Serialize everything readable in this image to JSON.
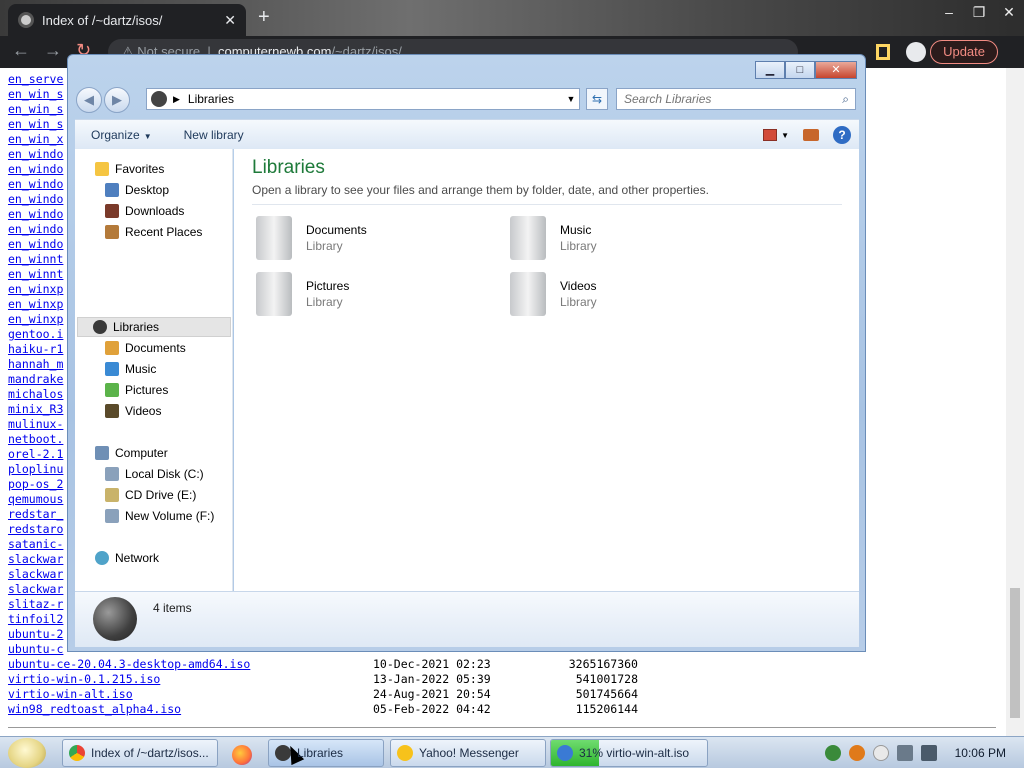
{
  "browser": {
    "tab_title": "Index of /~dartz/isos/",
    "new_tab": "+",
    "omnibox_prefix": "Not secure",
    "omnibox_host": "computernewb.com",
    "omnibox_path": "/~dartz/isos/",
    "update_label": "Update",
    "window_controls": [
      "–",
      "❐",
      "✕"
    ]
  },
  "listing": {
    "truncated_links": [
      "en_serve",
      "en_win_s",
      "en_win_s",
      "en_win_s",
      "en_win_x",
      "en_windo",
      "en_windo",
      "en_windo",
      "en_windo",
      "en_windo",
      "en_windo",
      "en_windo",
      "en_winnt",
      "en_winnt",
      "en_winxp",
      "en_winxp",
      "en_winxp",
      "gentoo.i",
      "haiku-r1",
      "hannah_m",
      "mandrake",
      "michalos",
      "minix_R3",
      "mulinux-",
      "netboot.",
      "orel-2.1",
      "ploplinu",
      "pop-os_2",
      "qemumous",
      "redstar_",
      "redstaro",
      "satanic-",
      "slackwar",
      "slackwar",
      "slackwar",
      "slitaz-r",
      "tinfoil2",
      "ubuntu-2",
      "ubuntu-c"
    ],
    "rows": [
      {
        "name": "ubuntu-ce-20.04.3-desktop-amd64.iso",
        "date": "10-Dec-2021 02:23",
        "size": "3265167360"
      },
      {
        "name": "virtio-win-0.1.215.iso",
        "date": "13-Jan-2022 05:39",
        "size": "541001728"
      },
      {
        "name": "virtio-win-alt.iso",
        "date": "24-Aug-2021 20:54",
        "size": "501745664"
      },
      {
        "name": "win98_redtoast_alpha4.iso",
        "date": "05-Feb-2022 04:42",
        "size": "115206144"
      }
    ]
  },
  "explorer": {
    "address_path": "Libraries",
    "search_placeholder": "Search Libraries",
    "commands": {
      "organize": "Organize",
      "new_library": "New library"
    },
    "nav": {
      "favorites": "Favorites",
      "favorites_items": [
        "Desktop",
        "Downloads",
        "Recent Places"
      ],
      "libraries": "Libraries",
      "libraries_items": [
        "Documents",
        "Music",
        "Pictures",
        "Videos"
      ],
      "computer": "Computer",
      "computer_items": [
        "Local Disk (C:)",
        "CD Drive (E:)",
        "New Volume (F:)"
      ],
      "network": "Network"
    },
    "content": {
      "title": "Libraries",
      "subtitle": "Open a library to see your files and arrange them by folder, date, and other properties.",
      "libraries": [
        {
          "name": "Documents",
          "type": "Library"
        },
        {
          "name": "Music",
          "type": "Library"
        },
        {
          "name": "Pictures",
          "type": "Library"
        },
        {
          "name": "Videos",
          "type": "Library"
        }
      ]
    },
    "details": {
      "count": "4 items"
    }
  },
  "taskbar": {
    "buttons": [
      {
        "label": "Index of /~dartz/isos..."
      },
      {
        "label": "Libraries"
      },
      {
        "label": "Yahoo! Messenger"
      },
      {
        "label": "31% virtio-win-alt.iso",
        "progress": 0.31
      }
    ],
    "clock": "10:06 PM"
  },
  "colors": {
    "chrome_dark": "#202124",
    "update_red": "#f28b82",
    "link_blue": "#0000ee",
    "explorer_title_green": "#1e7a3a",
    "download_green": "#2fb52f"
  }
}
